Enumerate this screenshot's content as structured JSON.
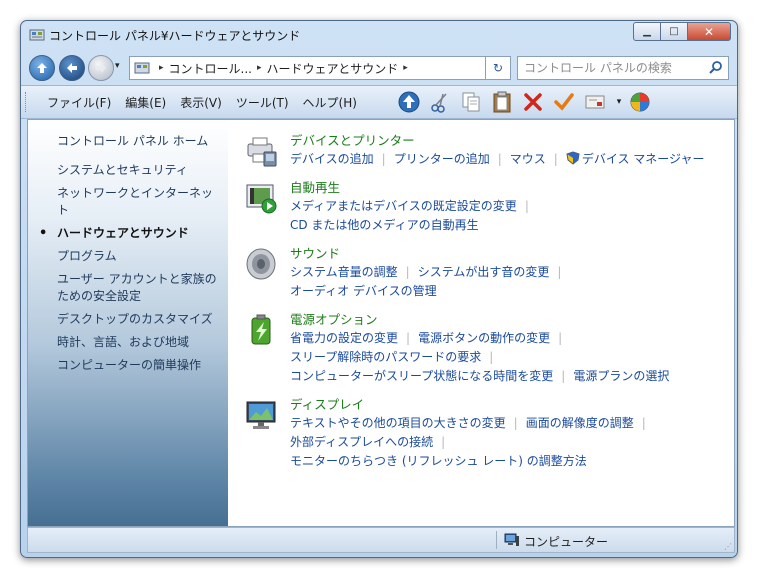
{
  "window": {
    "title": "コントロール パネル¥ハードウェアとサウンド",
    "min_glyph": "▁",
    "max_glyph": "□",
    "close_glyph": "✕"
  },
  "nav": {
    "breadcrumb": [
      "コントロール...",
      "ハードウェアとサウンド"
    ],
    "sep_glyph": "▸",
    "dropdown_glyph": "▾",
    "refresh_glyph": "↻"
  },
  "search": {
    "placeholder": "コントロール パネルの検索"
  },
  "menubar": {
    "file": "ファイル(F)",
    "edit": "編集(E)",
    "view": "表示(V)",
    "tools": "ツール(T)",
    "help": "ヘルプ(H)"
  },
  "toolbar_icons": [
    "up-icon",
    "cut-icon",
    "copy-icon",
    "paste-icon",
    "delete-icon",
    "checkmark-icon",
    "properties-icon",
    "views-icon"
  ],
  "sidebar": {
    "home": "コントロール パネル ホーム",
    "items": [
      {
        "label": "システムとセキュリティ"
      },
      {
        "label": "ネットワークとインターネット"
      },
      {
        "label": "ハードウェアとサウンド",
        "current": true
      },
      {
        "label": "プログラム"
      },
      {
        "label": "ユーザー アカウントと家族のための安全設定"
      },
      {
        "label": "デスクトップのカスタマイズ"
      },
      {
        "label": "時計、言語、および地域"
      },
      {
        "label": "コンピューターの簡単操作"
      }
    ]
  },
  "categories": [
    {
      "title": "デバイスとプリンター",
      "icon": "printer-icon",
      "links": [
        "デバイスの追加",
        "プリンターの追加",
        "マウス",
        "デバイス マネージャー"
      ]
    },
    {
      "title": "自動再生",
      "icon": "autoplay-icon",
      "links": [
        "メディアまたはデバイスの既定設定の変更",
        "CD または他のメディアの自動再生"
      ]
    },
    {
      "title": "サウンド",
      "icon": "speaker-icon",
      "links": [
        "システム音量の調整",
        "システムが出す音の変更",
        "オーディオ デバイスの管理"
      ]
    },
    {
      "title": "電源オプション",
      "icon": "battery-icon",
      "links": [
        "省電力の設定の変更",
        "電源ボタンの動作の変更",
        "スリープ解除時のパスワードの要求",
        "コンピューターがスリープ状態になる時間を変更",
        "電源プランの選択"
      ]
    },
    {
      "title": "ディスプレイ",
      "icon": "monitor-icon",
      "links": [
        "テキストやその他の項目の大きさの変更",
        "画面の解像度の調整",
        "外部ディスプレイへの接続",
        "モニターのちらつき (リフレッシュ レート) の調整方法"
      ]
    }
  ],
  "statusbar": {
    "location": "コンピューター"
  },
  "colors": {
    "link": "#1a4a9b",
    "category_title": "#1d7c1a",
    "sidebar_text": "#1e395b"
  }
}
